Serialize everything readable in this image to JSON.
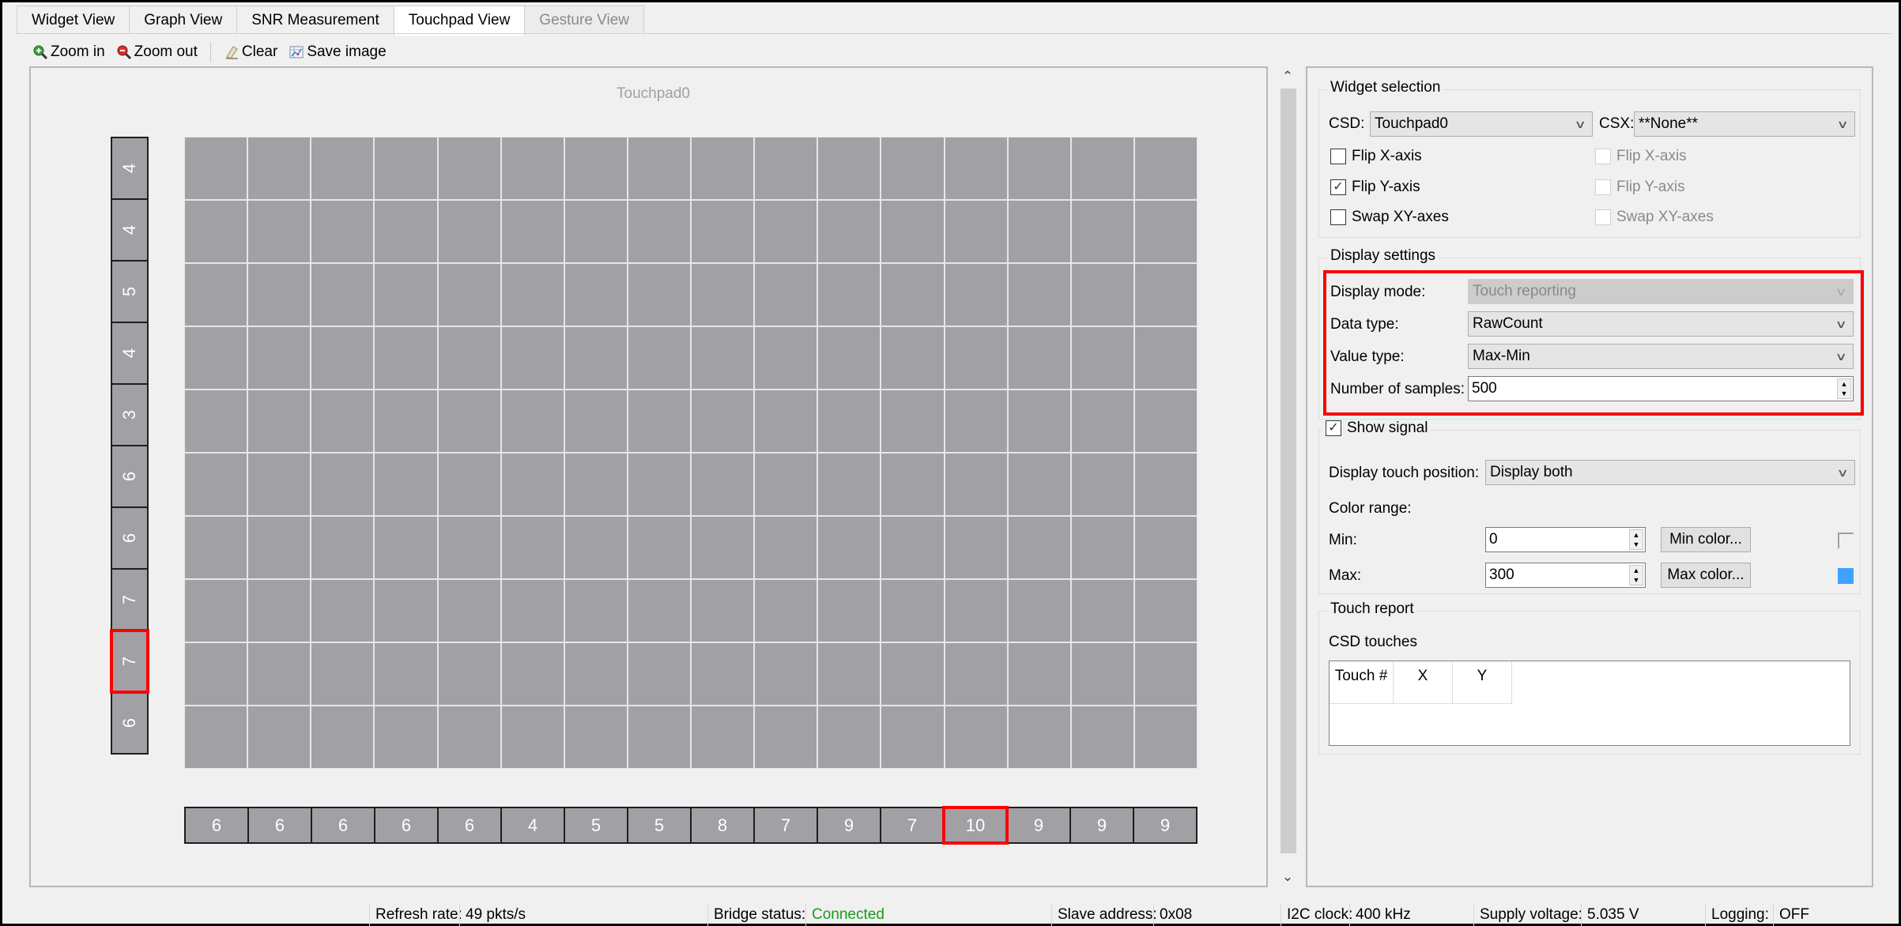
{
  "tabs": [
    {
      "label": "Widget View",
      "state": "normal"
    },
    {
      "label": "Graph View",
      "state": "normal"
    },
    {
      "label": "SNR Measurement",
      "state": "normal"
    },
    {
      "label": "Touchpad View",
      "state": "active"
    },
    {
      "label": "Gesture View",
      "state": "disabled"
    }
  ],
  "toolbar": {
    "zoom_in": {
      "label": "Zoom in",
      "icon": "zoom-in-icon"
    },
    "zoom_out": {
      "label": "Zoom out",
      "icon": "zoom-out-icon"
    },
    "clear": {
      "label": "Clear",
      "icon": "eraser-icon"
    },
    "save_image": {
      "label": "Save image",
      "icon": "save-image-icon"
    }
  },
  "touchpad": {
    "title": "Touchpad0",
    "grid_rows": 10,
    "grid_cols": 16,
    "cell_color": "#a1a0a5",
    "row_values": [
      "4",
      "4",
      "5",
      "4",
      "3",
      "6",
      "6",
      "7",
      "7",
      "6"
    ],
    "row_highlight_index": 8,
    "col_values": [
      "6",
      "6",
      "6",
      "6",
      "6",
      "4",
      "5",
      "5",
      "8",
      "7",
      "9",
      "7",
      "10",
      "9",
      "9",
      "9"
    ],
    "col_highlight_index": 12,
    "highlight_color": "#ff0000"
  },
  "widget_selection": {
    "title": "Widget selection",
    "csd_label": "CSD:",
    "csd_value": "Touchpad0",
    "csx_label": "CSX:",
    "csx_value": "**None**",
    "csd_checks": [
      {
        "label": "Flip X-axis",
        "checked": false
      },
      {
        "label": "Flip Y-axis",
        "checked": true
      },
      {
        "label": "Swap XY-axes",
        "checked": false
      }
    ],
    "csx_checks": [
      {
        "label": "Flip X-axis",
        "checked": false,
        "disabled": true
      },
      {
        "label": "Flip Y-axis",
        "checked": false,
        "disabled": true
      },
      {
        "label": "Swap XY-axes",
        "checked": false,
        "disabled": true
      }
    ]
  },
  "display_settings": {
    "title": "Display settings",
    "display_mode_label": "Display mode:",
    "display_mode_value": "Touch reporting",
    "data_type_label": "Data type:",
    "data_type_value": "RawCount",
    "value_type_label": "Value type:",
    "value_type_value": "Max-Min",
    "samples_label": "Number of samples:",
    "samples_value": "500"
  },
  "show_signal": {
    "label": "Show signal",
    "checked": true,
    "touch_position_label": "Display touch position:",
    "touch_position_value": "Display both",
    "color_range_label": "Color range:",
    "min_label": "Min:",
    "min_value": "0",
    "min_color_button": "Min color...",
    "min_color": "#f0f0f0",
    "max_label": "Max:",
    "max_value": "300",
    "max_color_button": "Max color...",
    "max_color": "#3fa2ff"
  },
  "touch_report": {
    "title": "Touch report",
    "csd_touches_label": "CSD touches",
    "columns": [
      "Touch #",
      "X",
      "Y"
    ],
    "rows": []
  },
  "statusbar": {
    "refresh_rate_label": "Refresh rate:",
    "refresh_rate_value": "49 pkts/s",
    "bridge_status_label": "Bridge status:",
    "bridge_status_value": "Connected",
    "bridge_status_color": "#1a9a1a",
    "slave_address_label": "Slave address:",
    "slave_address_value": "0x08",
    "i2c_clock_label": "I2C clock:",
    "i2c_clock_value": "400 kHz",
    "supply_voltage_label": "Supply voltage:",
    "supply_voltage_value": "5.035 V",
    "logging_label": "Logging:",
    "logging_value": "OFF"
  }
}
